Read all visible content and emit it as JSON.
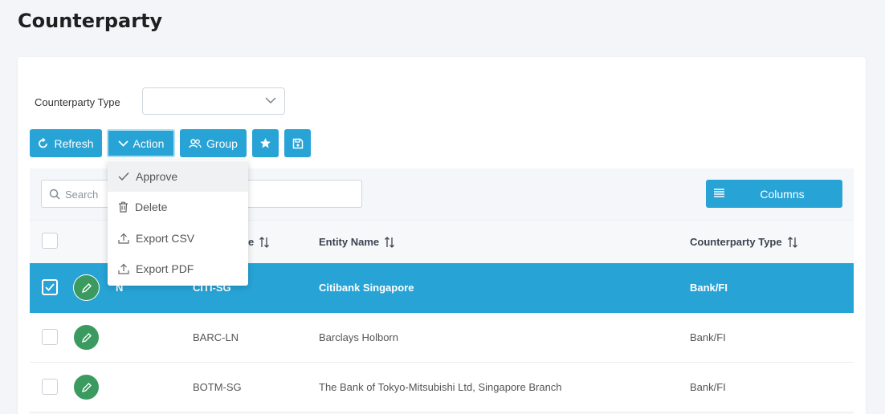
{
  "page": {
    "title": "Counterparty"
  },
  "filter": {
    "label": "Counterparty Type",
    "value": ""
  },
  "toolbar": {
    "refresh_label": "Refresh",
    "action_label": "Action",
    "group_label": "Group"
  },
  "action_menu": {
    "items": [
      {
        "label": "Approve",
        "icon": "check-icon"
      },
      {
        "label": "Delete",
        "icon": "trash-icon"
      },
      {
        "label": "Export CSV",
        "icon": "upload-icon"
      },
      {
        "label": "Export PDF",
        "icon": "upload-icon"
      }
    ]
  },
  "grid": {
    "search_placeholder": "Search",
    "columns_label": "Columns",
    "headers": {
      "code_partial": "e",
      "entity_name": "Entity Name",
      "counterparty_type": "Counterparty Type"
    },
    "rows": [
      {
        "flag": "N",
        "code": "CITI-SG",
        "entity_name": "Citibank Singapore",
        "type": "Bank/FI",
        "checked": true
      },
      {
        "flag": "",
        "code": "BARC-LN",
        "entity_name": "Barclays Holborn",
        "type": "Bank/FI",
        "checked": false
      },
      {
        "flag": "",
        "code": "BOTM-SG",
        "entity_name": "The Bank of Tokyo-Mitsubishi Ltd, Singapore Branch",
        "type": "Bank/FI",
        "checked": false
      }
    ]
  },
  "colors": {
    "accent": "#27a3d6",
    "edit": "#3a9a5f"
  }
}
